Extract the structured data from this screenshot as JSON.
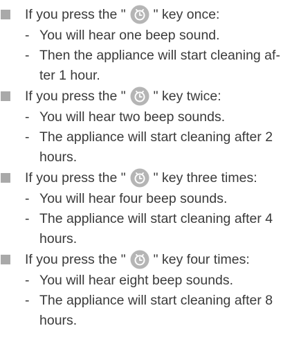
{
  "sections": [
    {
      "heading_before": "If you press the \"",
      "heading_after": "\" key once:",
      "items": [
        "You will hear one beep sound.",
        "Then the appliance will start cleaning af-ter 1 hour."
      ]
    },
    {
      "heading_before": "If you press the \"",
      "heading_after": "\" key twice:",
      "items": [
        "You will hear two beep sounds.",
        "The appliance will start cleaning after 2 hours."
      ]
    },
    {
      "heading_before": "If you press the \"",
      "heading_after": "\" key three times:",
      "items": [
        "You will hear four beep sounds.",
        "The appliance will start cleaning after 4 hours."
      ]
    },
    {
      "heading_before": "If you press the \"",
      "heading_after": "\" key four times:",
      "items": [
        "You will hear eight beep sounds.",
        "The appliance will start cleaning after 8 hours."
      ]
    }
  ],
  "dash": "-",
  "icon": "timer-clock-icon",
  "colors": {
    "text": "#3a3a3a",
    "bullet": "#a9a9a9",
    "icon_bg": "#b5b5b5",
    "icon_fg": "#ffffff"
  }
}
